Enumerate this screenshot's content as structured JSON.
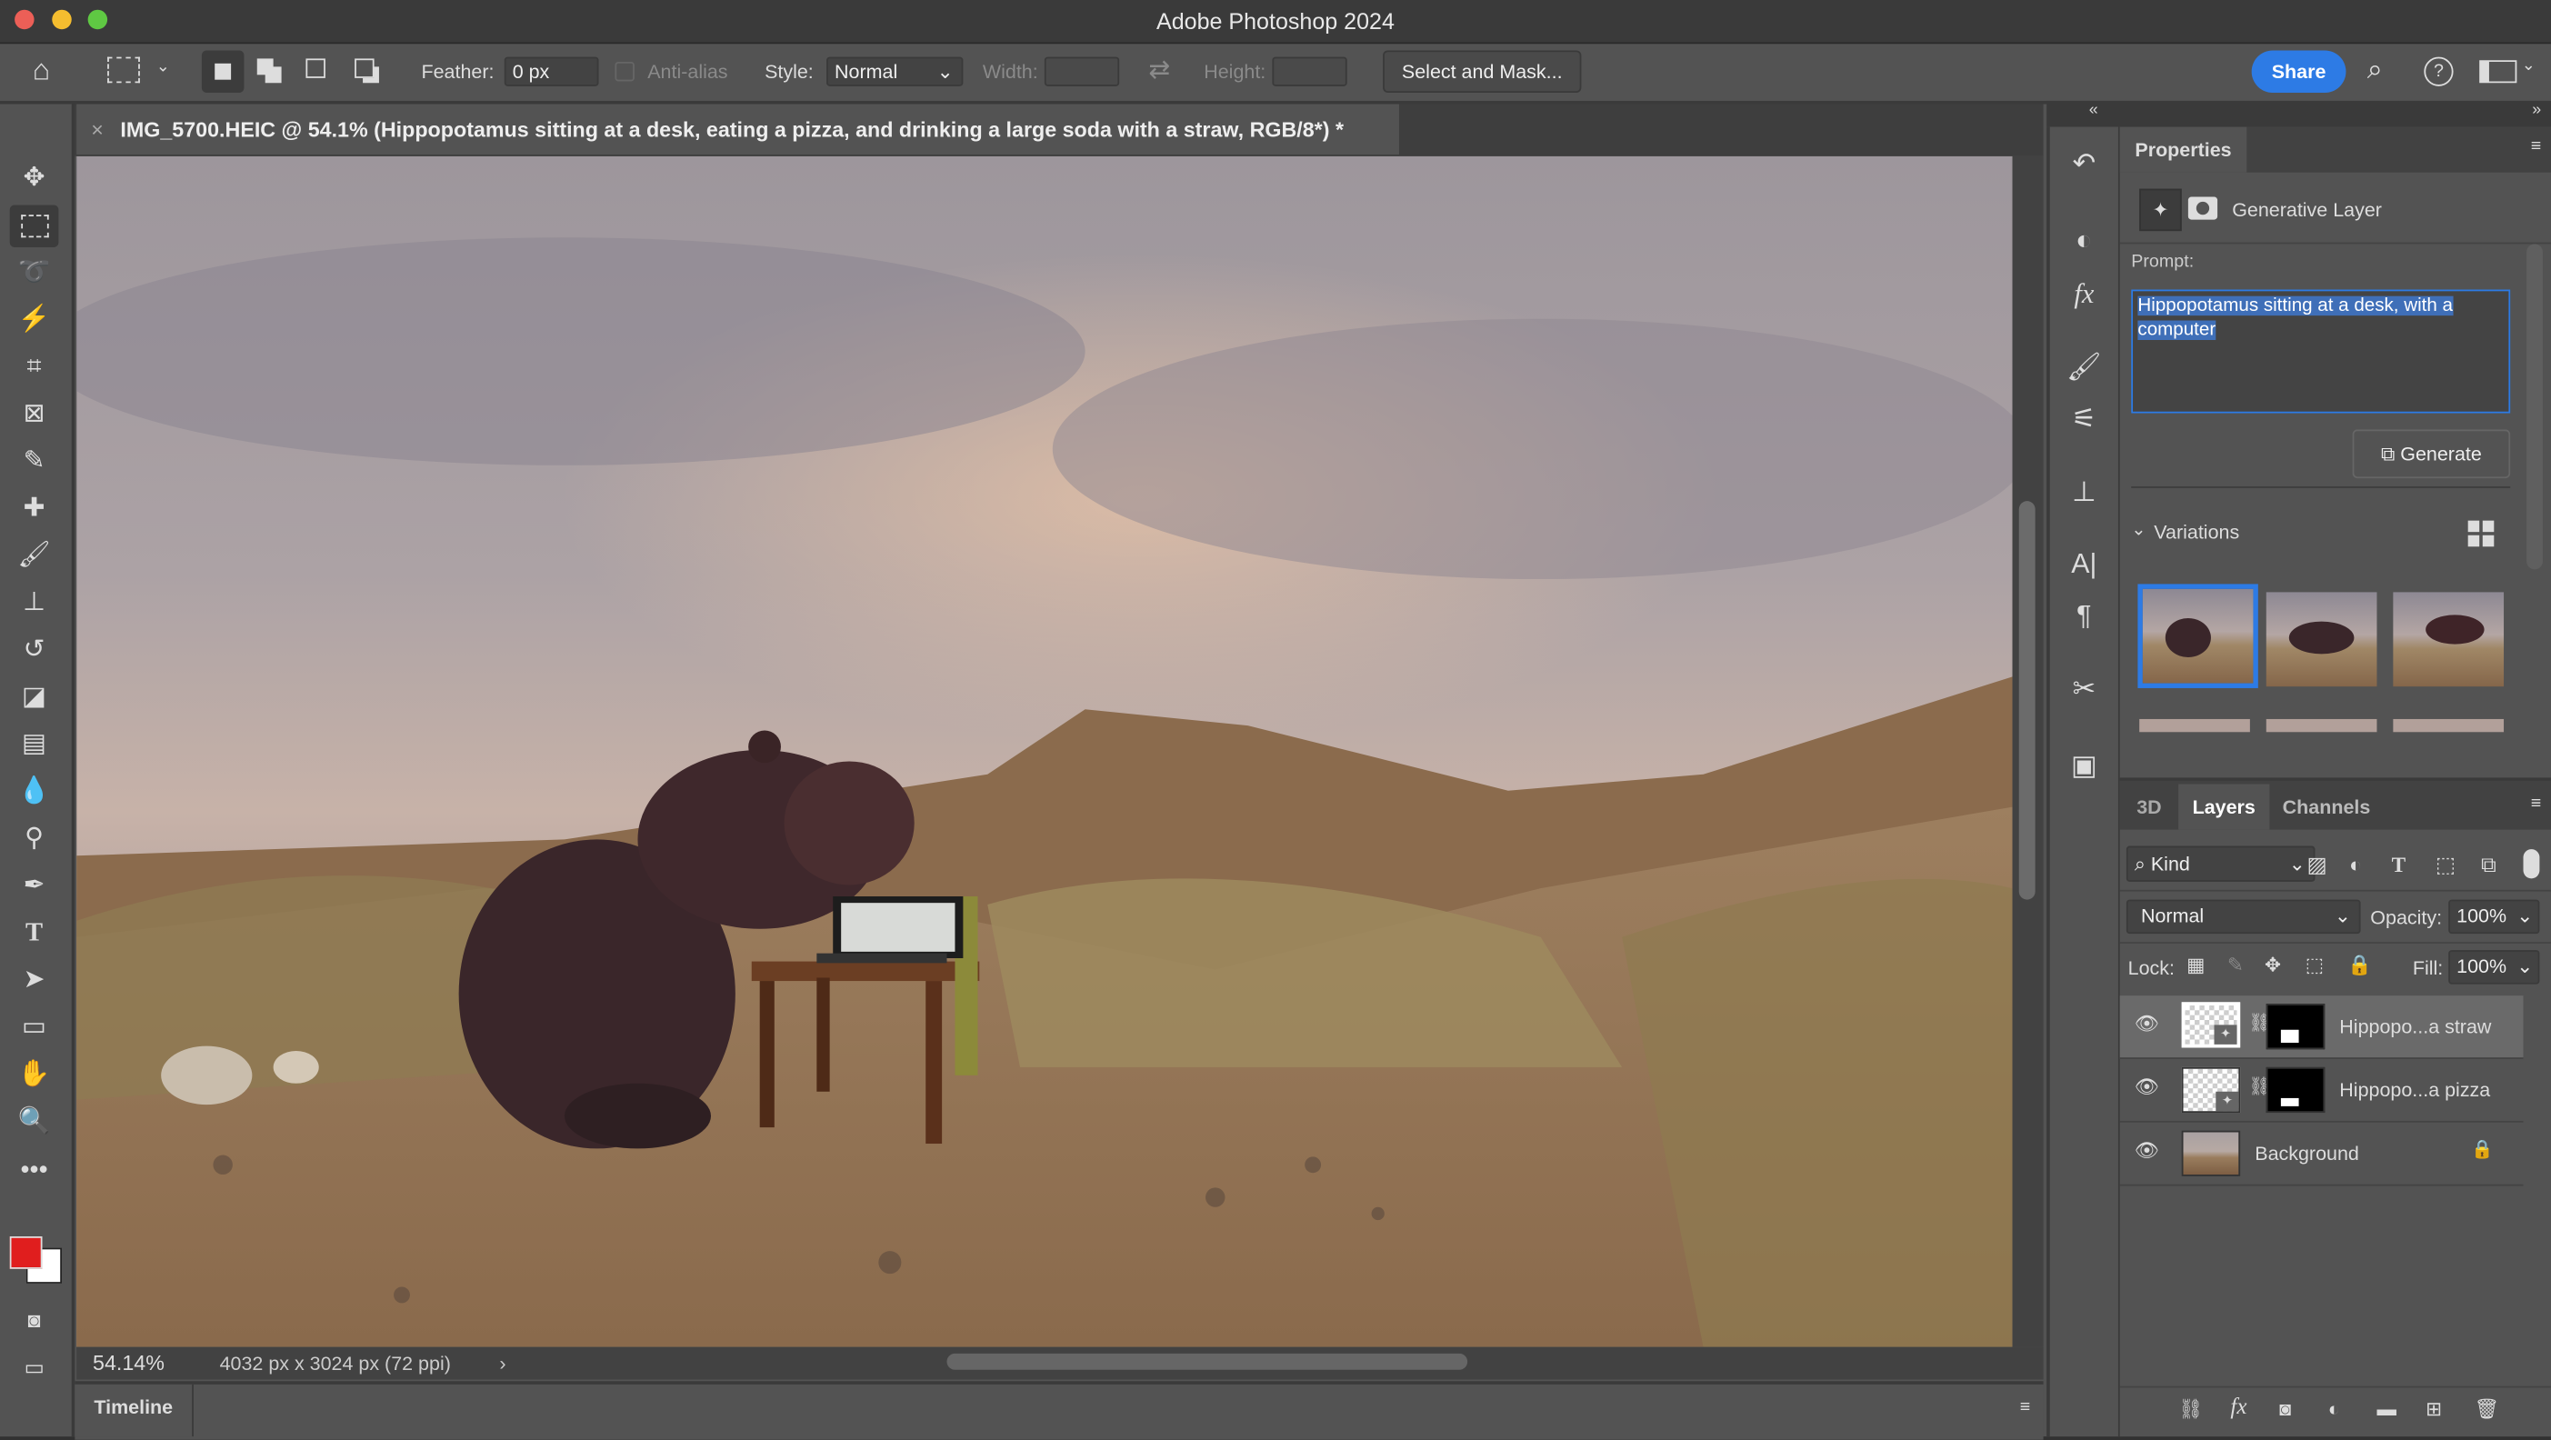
{
  "app": {
    "title": "Adobe Photoshop 2024"
  },
  "window_controls": {
    "close": "#ec5f57",
    "minimize": "#f5bd2f",
    "maximize": "#5fc843"
  },
  "options": {
    "feather_label": "Feather:",
    "feather_value": "0 px",
    "antialias_label": "Anti-alias",
    "style_label": "Style:",
    "style_value": "Normal",
    "width_label": "Width:",
    "height_label": "Height:",
    "select_mask": "Select and Mask...",
    "share": "Share"
  },
  "document": {
    "tab_title": "IMG_5700.HEIC @ 54.1% (Hippopotamus sitting at a desk, eating a pizza, and drinking a large soda with a straw, RGB/8*) *",
    "zoom": "54.14%",
    "dimensions": "4032 px x 3024 px (72 ppi)"
  },
  "timeline": {
    "label": "Timeline"
  },
  "colors": {
    "foreground": "#e01e1e",
    "background": "#ffffff",
    "accent": "#2d7be5"
  },
  "properties": {
    "tab": "Properties",
    "layer_type": "Generative Layer",
    "prompt_label": "Prompt:",
    "prompt_value": "Hippopotamus sitting at a desk, with a computer",
    "generate": "Generate",
    "variations_label": "Variations"
  },
  "layers_panel": {
    "tabs": [
      "3D",
      "Layers",
      "Channels"
    ],
    "filter": "Kind",
    "blend_mode": "Normal",
    "opacity_label": "Opacity:",
    "opacity": "100%",
    "lock_label": "Lock:",
    "fill_label": "Fill:",
    "fill": "100%",
    "layers": [
      {
        "name": "Hippopo...a straw",
        "visible": true,
        "selected": true
      },
      {
        "name": "Hippopo...a pizza",
        "visible": true,
        "selected": false
      },
      {
        "name": "Background",
        "visible": true,
        "locked": true
      }
    ]
  }
}
